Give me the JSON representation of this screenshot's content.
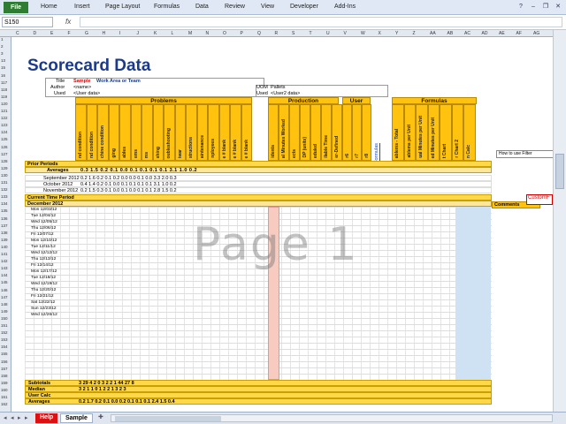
{
  "ribbon": {
    "file": "File",
    "tabs": [
      "Home",
      "Insert",
      "Page Layout",
      "Formulas",
      "Data",
      "Review",
      "View",
      "Developer",
      "Add-Ins"
    ]
  },
  "formula_bar": {
    "name_box": "S150",
    "fx": "fx"
  },
  "columns": [
    "C",
    "D",
    "E",
    "F",
    "G",
    "H",
    "I",
    "J",
    "K",
    "L",
    "M",
    "N",
    "O",
    "P",
    "Q",
    "R",
    "S",
    "T",
    "U",
    "V",
    "W",
    "X",
    "Y",
    "Z",
    "AA",
    "AB",
    "AC",
    "AD",
    "AE",
    "AF",
    "AG"
  ],
  "row_numbers": [
    "1",
    "2",
    "3",
    "13",
    "15",
    "16",
    "117",
    "118",
    "119",
    "120",
    "121",
    "122",
    "123",
    "124",
    "125",
    "126",
    "127",
    "128",
    "129",
    "130",
    "131",
    "132",
    "133",
    "134",
    "135",
    "136",
    "137",
    "138",
    "139",
    "140",
    "141",
    "142",
    "143",
    "144",
    "145",
    "146",
    "147",
    "148",
    "149",
    "150",
    "151",
    "152",
    "153",
    "154",
    "155",
    "156",
    "157",
    "158",
    "159",
    "160",
    "161",
    "162"
  ],
  "sheet": {
    "title": "Scorecard Data",
    "title_label": "Title",
    "title_value_red": "Sample",
    "title_value": "Work Area or Team",
    "author_label": "Author",
    "author_value": "<name>",
    "used_label": "Used",
    "used_value": "<User data>",
    "uom_label": "UOM",
    "uom_value": "Pallets",
    "used2_label": "Used",
    "used2_value": "<User2 data>",
    "sections": {
      "problems": "Problems",
      "production": "Production",
      "user": "User",
      "formulas": "Formulas"
    },
    "problem_cols": [
      "nd condition",
      "nd condition",
      "chine condition",
      "ging",
      "ables",
      "ems",
      "ms",
      "shing",
      "oubleshooting",
      "iwar",
      "structions",
      "aintenance",
      "nployees",
      "e # blank",
      "e # blank",
      "e # blank"
    ],
    "production_cols": [
      "idents",
      "al Minutes Worked",
      "ects",
      "DP (units)",
      "eduled",
      "ilable Time",
      "er-Defined"
    ],
    "user_cols": [
      "r6",
      "r7",
      "r8"
    ],
    "formula_cols": [
      "ablems - Total",
      "ablems per Unit",
      "ual Minutes per Unit",
      "ed Minutes per Unit",
      "t Chart",
      "r Chart 2",
      "n Calc"
    ],
    "formulas_link": "Formulas",
    "prior_periods": "Prior Periods",
    "averages": "Averages",
    "averages_values": "0.3  1.5  0.2  0.1  0.0  0.1  0.1  0.1  0.1  3.1  1.0  0.2",
    "prior_rows": [
      {
        "label": "September 2012",
        "vals": "0.2  1.6  0.2  0.1  0.2  0.0  0.0  0.1  0.0  3.3  2.0  0.3"
      },
      {
        "label": "October 2012",
        "vals": "0.4  1.4  0.2  0.1  0.0  0.1  0.1  0.1  0.1  3.1  1.0  0.2"
      },
      {
        "label": "November 2012",
        "vals": "0.2  1.5  0.3  0.1  0.0  0.1  0.0  0.1  0.1  2.8  1.5  0.2"
      }
    ],
    "current_period": "Current Time Period",
    "month": "December 2012",
    "day_rows": [
      "Mon 12/03/12",
      "Tue 12/04/12",
      "Wed 12/05/12",
      "Thu 12/06/12",
      "Fri 12/07/12",
      "Mon 12/10/12",
      "Tue 12/11/12",
      "Wed 12/12/12",
      "Thu 12/13/12",
      "Fri 12/14/12",
      "Mon 12/17/12",
      "Tue 12/18/12",
      "Wed 12/19/12",
      "Thu 12/20/12",
      "Fri 12/21/12",
      "Sat 12/22/12",
      "Sun 12/23/12",
      "Wed 12/26/12"
    ],
    "subtotals": "Subtotals",
    "median": "Median",
    "user_calc": "User Calc",
    "averages_bottom": "Averages",
    "subtotal_vals": "3  29  4  2  0  3  2  2  1  44  27  8",
    "median_vals": "3  2  1  1  0  1  2  2  1  3  2  3",
    "avg_vals": "0.2  1.7  0.2  0.1  0.0  0.2  0.1  0.1  0.1  2.4  1.5  0.4",
    "comments": "Comments",
    "custom": "CustomF",
    "filter_hint": "How to use Filter",
    "watermark": "Page 1"
  },
  "sheet_tabs": [
    "Help",
    "Sample"
  ]
}
